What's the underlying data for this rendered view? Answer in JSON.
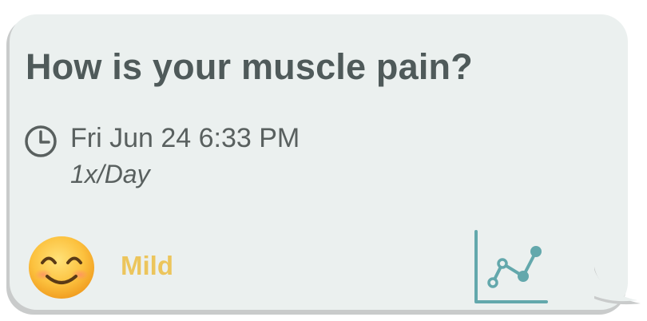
{
  "card": {
    "question": "How is your muscle pain?",
    "datetime": "Fri Jun 24 6:33 PM",
    "frequency": "1x/Day",
    "rating": {
      "label": "Mild",
      "emoji": "smiling-face-with-smiling-eyes",
      "color": "#ecc55c"
    },
    "icons": {
      "schedule": "clock-icon",
      "trend": "trend-chart-icon"
    }
  },
  "colors": {
    "bubble": "#ebf0ef",
    "text": "#4f5a5a",
    "accent": "#63a8ac"
  }
}
